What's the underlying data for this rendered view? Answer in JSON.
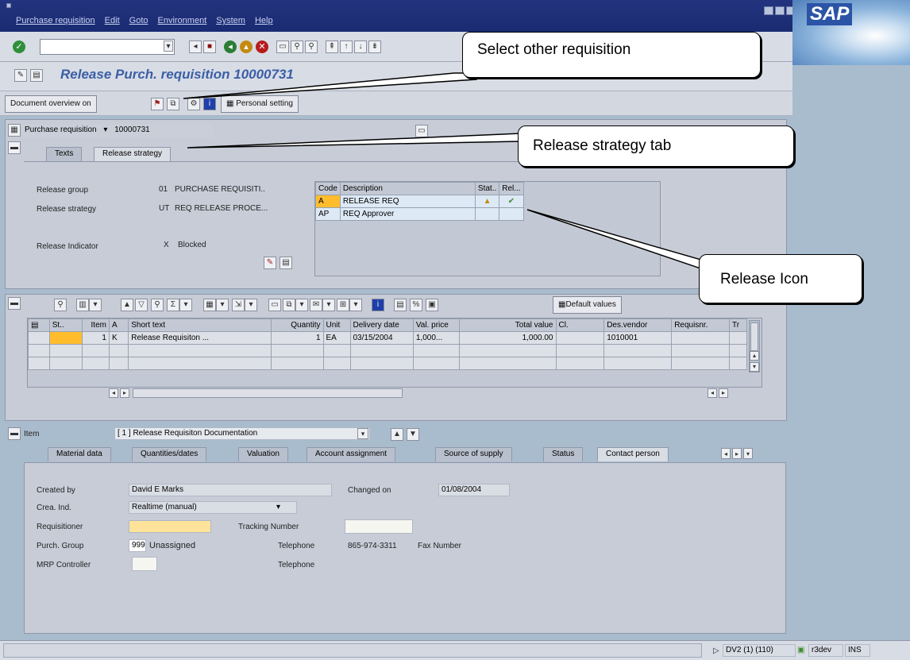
{
  "menu": [
    "Purchase requisition",
    "Edit",
    "Goto",
    "Environment",
    "System",
    "Help"
  ],
  "logo": "SAP",
  "title": "Release Purch. requisition 10000731",
  "app_toolbar": {
    "doc_overview": "Document overview on",
    "personal_setting": "Personal setting"
  },
  "header": {
    "label": "Purchase requisition",
    "number": "10000731"
  },
  "top_tabs": [
    "Texts",
    "Release strategy"
  ],
  "release": {
    "group_label": "Release group",
    "group_code": "01",
    "group_value": "PURCHASE REQUISITI..",
    "strategy_label": "Release strategy",
    "strategy_code": "UT",
    "strategy_value": "REQ RELEASE PROCE...",
    "indicator_label": "Release Indicator",
    "indicator_code": "X",
    "indicator_value": "Blocked"
  },
  "release_table": {
    "headers": [
      "Code",
      "Description",
      "Stat..",
      "Rel..."
    ],
    "rows": [
      {
        "code": "A",
        "desc": "RELEASE REQ"
      },
      {
        "code": "AP",
        "desc": "REQ Approver"
      }
    ]
  },
  "items_toolbar": {
    "default_values": "Default values"
  },
  "items_table": {
    "headers": [
      "St..",
      "Item",
      "A",
      "Short text",
      "Quantity",
      "Unit",
      "Delivery date",
      "Val. price",
      "Total value",
      "Cl.",
      "Des.vendor",
      "Requisnr.",
      "Tr"
    ],
    "row": {
      "item": "1",
      "a": "K",
      "short_text": "Release Requisiton ...",
      "quantity": "1",
      "unit": "EA",
      "delivery": "03/15/2004",
      "val_price": "1,000...",
      "total": "1,000.00",
      "vendor": "1010001"
    }
  },
  "item_selector": {
    "label": "Item",
    "value": "[ 1 ] Release Requisiton Documentation"
  },
  "item_tabs": [
    "Material data",
    "Quantities/dates",
    "Valuation",
    "Account assignment",
    "Source of supply",
    "Status",
    "Contact person"
  ],
  "contact": {
    "created_by_label": "Created by",
    "created_by": "David E Marks",
    "changed_on_label": "Changed on",
    "changed_on": "01/08/2004",
    "crea_ind_label": "Crea. Ind.",
    "crea_ind": "Realtime (manual)",
    "requisitioner_label": "Requisitioner",
    "tracking_label": "Tracking Number",
    "purch_group_label": "Purch. Group",
    "purch_group_code": "999",
    "purch_group_value": "Unassigned",
    "telephone_label": "Telephone",
    "telephone": "865-974-3311",
    "fax_label": "Fax Number",
    "mrp_label": "MRP Controller",
    "telephone2_label": "Telephone"
  },
  "status": {
    "system": "DV2 (1) (110)",
    "server": "r3dev",
    "mode": "INS"
  },
  "callouts": {
    "select_other": "Select other requisition",
    "release_tab": "Release strategy tab",
    "release_icon": "Release Icon"
  }
}
